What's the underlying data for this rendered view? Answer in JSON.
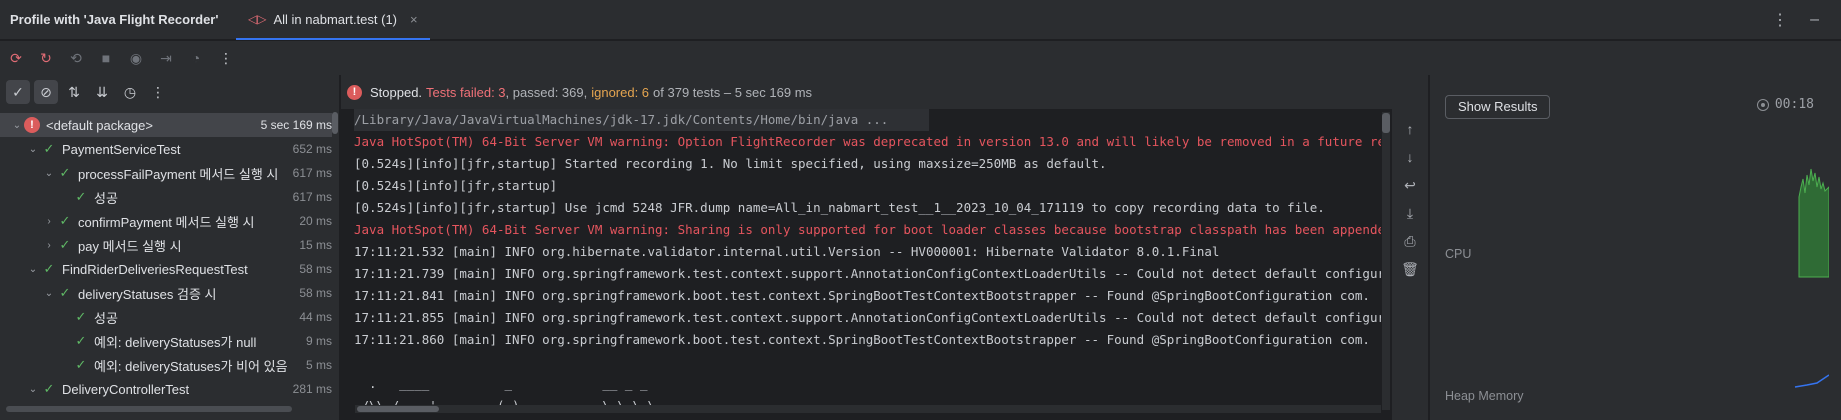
{
  "titlebar": {
    "app_title": "Profile with 'Java Flight Recorder'",
    "tab_label": "All in nabmart.test (1)",
    "tab_close": "×",
    "menu_icon": "⋮",
    "minimize_icon": "–"
  },
  "toolbar": {
    "icons": [
      "rerun-failed-icon",
      "rerun-icon",
      "debug-failed-icon",
      "stop-icon",
      "snapshot-icon",
      "export-icon",
      "coverage-icon",
      "more-icon"
    ]
  },
  "left_toolbar": {
    "icons": [
      "show-passed-icon",
      "show-ignored-icon",
      "sort-alpha-icon",
      "sort-duration-icon",
      "history-icon",
      "more-icon"
    ]
  },
  "tree": [
    {
      "label": "<default package>",
      "time": "5 sec 169 ms",
      "status": "failed",
      "indent": 0,
      "expanded": true,
      "selected": true
    },
    {
      "label": "PaymentServiceTest",
      "time": "652 ms",
      "status": "passed",
      "indent": 1,
      "expanded": true
    },
    {
      "label": "processFailPayment 메서드 실행 시",
      "time": "617 ms",
      "status": "passed",
      "indent": 2,
      "expanded": true
    },
    {
      "label": "성공",
      "time": "617 ms",
      "status": "passed",
      "indent": 3,
      "expanded": null
    },
    {
      "label": "confirmPayment 메서드 실행 시",
      "time": "20 ms",
      "status": "passed",
      "indent": 2,
      "expanded": false
    },
    {
      "label": "pay 메서드 실행 시",
      "time": "15 ms",
      "status": "passed",
      "indent": 2,
      "expanded": false
    },
    {
      "label": "FindRiderDeliveriesRequestTest",
      "time": "58 ms",
      "status": "passed",
      "indent": 1,
      "expanded": true
    },
    {
      "label": "deliveryStatuses 검증 시",
      "time": "58 ms",
      "status": "passed",
      "indent": 2,
      "expanded": true
    },
    {
      "label": "성공",
      "time": "44 ms",
      "status": "passed",
      "indent": 3,
      "expanded": null
    },
    {
      "label": "예외: deliveryStatuses가 null",
      "time": "9 ms",
      "status": "passed",
      "indent": 3,
      "expanded": null
    },
    {
      "label": "예외: deliveryStatuses가 비어 있음",
      "time": "5 ms",
      "status": "passed",
      "indent": 3,
      "expanded": null
    },
    {
      "label": "DeliveryControllerTest",
      "time": "281 ms",
      "status": "passed",
      "indent": 1,
      "expanded": true
    }
  ],
  "status": {
    "stopped": "Stopped.",
    "failed": "Tests failed: 3",
    "passed": ", passed: 369,",
    "ignored": "ignored: 6",
    "rest": "of 379 tests – 5 sec 169 ms"
  },
  "console": [
    {
      "text": "/Library/Java/JavaVirtualMachines/jdk-17.jdk/Contents/Home/bin/java ...",
      "kind": "first"
    },
    {
      "text": "Java HotSpot(TM) 64-Bit Server VM warning: Option FlightRecorder was deprecated in version 13.0 and will likely be removed in a future release.",
      "kind": "red"
    },
    {
      "text": "[0.524s][info][jfr,startup] Started recording 1. No limit specified, using maxsize=250MB as default.",
      "kind": "normal"
    },
    {
      "text": "[0.524s][info][jfr,startup]",
      "kind": "normal"
    },
    {
      "text": "[0.524s][info][jfr,startup] Use jcmd 5248 JFR.dump name=All_in_nabmart_test__1__2023_10_04_171119 to copy recording data to file.",
      "kind": "normal"
    },
    {
      "text": "Java HotSpot(TM) 64-Bit Server VM warning: Sharing is only supported for boot loader classes because bootstrap classpath has been appended",
      "kind": "red"
    },
    {
      "text": "17:11:21.532 [main] INFO org.hibernate.validator.internal.util.Version -- HV000001: Hibernate Validator 8.0.1.Final",
      "kind": "normal"
    },
    {
      "text": "17:11:21.739 [main] INFO org.springframework.test.context.support.AnnotationConfigContextLoaderUtils -- Could not detect default configuration",
      "kind": "normal"
    },
    {
      "text": "17:11:21.841 [main] INFO org.springframework.boot.test.context.SpringBootTestContextBootstrapper -- Found @SpringBootConfiguration com.",
      "kind": "normal"
    },
    {
      "text": "17:11:21.855 [main] INFO org.springframework.test.context.support.AnnotationConfigContextLoaderUtils -- Could not detect default configuration",
      "kind": "normal"
    },
    {
      "text": "17:11:21.860 [main] INFO org.springframework.boot.test.context.SpringBootTestContextBootstrapper -- Found @SpringBootConfiguration com.",
      "kind": "normal"
    },
    {
      "text": "",
      "kind": "normal"
    },
    {
      "text": "  .   ____          _            __ _ _",
      "kind": "normal"
    },
    {
      "text": " /\\\\ / ___'_ __ _ _(_)_ __  __ _ \\ \\ \\ \\",
      "kind": "normal"
    }
  ],
  "console_side": {
    "icons": [
      "up-arrow-icon",
      "down-arrow-icon",
      "soft-wrap-icon",
      "scroll-to-end-icon",
      "print-icon",
      "trash-icon"
    ]
  },
  "profiler": {
    "show_results": "Show Results",
    "timer": "00:18",
    "cpu_label": "CPU",
    "heap_label": "Heap Memory"
  },
  "colors": {
    "passed": "#5fb865",
    "failed": "#db5c5c",
    "ignored": "#e5a550",
    "accent": "#3574f0",
    "cpu_chart": "#4caf50",
    "heap_chart": "#3574f0"
  }
}
